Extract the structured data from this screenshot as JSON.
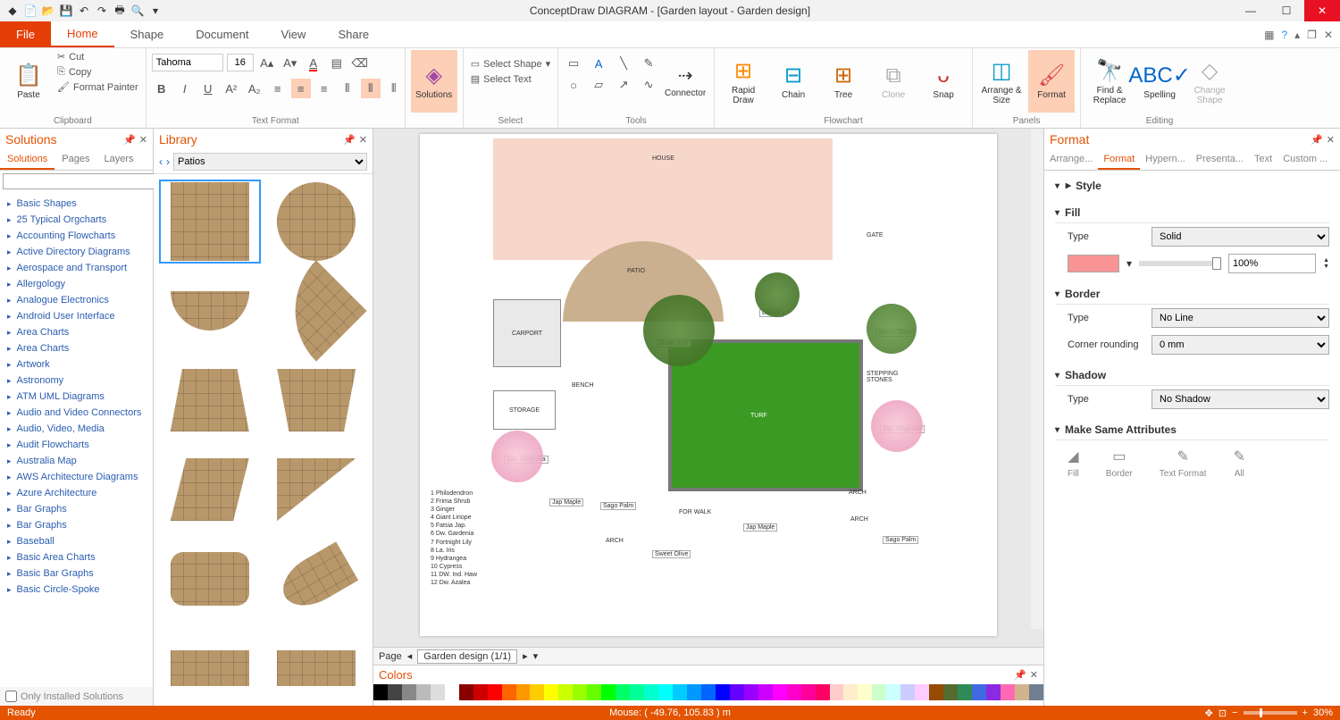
{
  "title": "ConceptDraw DIAGRAM - [Garden layout - Garden design]",
  "menubar": {
    "file": "File",
    "tabs": [
      "Home",
      "Shape",
      "Document",
      "View",
      "Share"
    ],
    "active": "Home"
  },
  "ribbon": {
    "clipboard": {
      "paste": "Paste",
      "cut": "Cut",
      "copy": "Copy",
      "painter": "Format Painter",
      "label": "Clipboard"
    },
    "text": {
      "font": "Tahoma",
      "size": "16",
      "label": "Text Format"
    },
    "solutions": {
      "label": "Solutions"
    },
    "select": {
      "shape": "Select Shape",
      "text": "Select Text",
      "label": "Select"
    },
    "tools": {
      "connector": "Connector",
      "label": "Tools"
    },
    "flowchart": {
      "rapid": "Rapid Draw",
      "chain": "Chain",
      "tree": "Tree",
      "clone": "Clone",
      "snap": "Snap",
      "label": "Flowchart"
    },
    "panels": {
      "arrange": "Arrange & Size",
      "format": "Format",
      "label": "Panels"
    },
    "editing": {
      "find": "Find & Replace",
      "spelling": "Spelling",
      "change": "Change Shape",
      "label": "Editing"
    }
  },
  "solutions_panel": {
    "title": "Solutions",
    "tabs": [
      "Solutions",
      "Pages",
      "Layers"
    ],
    "items": [
      "Basic Shapes",
      "25 Typical Orgcharts",
      "Accounting Flowcharts",
      "Active Directory Diagrams",
      "Aerospace and Transport",
      "Allergology",
      "Analogue Electronics",
      "Android User Interface",
      "Area Charts",
      "Area Charts",
      "Artwork",
      "Astronomy",
      "ATM UML Diagrams",
      "Audio and Video Connectors",
      "Audio, Video, Media",
      "Audit Flowcharts",
      "Australia Map",
      "AWS Architecture Diagrams",
      "Azure Architecture",
      "Bar Graphs",
      "Bar Graphs",
      "Baseball",
      "Basic Area Charts",
      "Basic Bar Graphs",
      "Basic Circle-Spoke"
    ],
    "only_installed": "Only Installed Solutions"
  },
  "library_panel": {
    "title": "Library",
    "category": "Patios"
  },
  "canvas": {
    "labels": {
      "house": "HOUSE",
      "patio": "PATIO",
      "carport": "CARPORT",
      "storage": "STORAGE",
      "bench": "BENCH",
      "turf": "TURF",
      "gate": "GATE",
      "forwalk": "FOR WALK",
      "stepping": "STEPPING STONES",
      "drake": "Drake Elm",
      "locust": "Locust",
      "sweetolive": "Sweet Olive",
      "japmag": "Jap. Magnolia",
      "japmaple": "Jap Maple",
      "sagopalm": "Sago Palm",
      "arch": "ARCH"
    },
    "legend": [
      "1  Philodendron",
      "2  Frima Shrub",
      "3  Ginger",
      "4  Giant Liriope",
      "5  Fatsia Jap.",
      "6  Dw. Gardenia",
      "7  Fortnight Lily",
      "8  La. Iris",
      "9  Hydrangea",
      "10 Cypress",
      "11 DW. Ind. Haw",
      "12 Dw. Azalea"
    ],
    "page_tab": "Garden design (1/1)",
    "page_label": "Page"
  },
  "colors_panel": {
    "title": "Colors"
  },
  "format_panel": {
    "title": "Format",
    "tabs": [
      "Arrange...",
      "Format",
      "Hypern...",
      "Presenta...",
      "Text",
      "Custom ..."
    ],
    "style": "Style",
    "fill": {
      "h": "Fill",
      "type_l": "Type",
      "type_v": "Solid",
      "opacity": "100%"
    },
    "border": {
      "h": "Border",
      "type_l": "Type",
      "type_v": "No Line",
      "corner_l": "Corner rounding",
      "corner_v": "0 mm"
    },
    "shadow": {
      "h": "Shadow",
      "type_l": "Type",
      "type_v": "No Shadow"
    },
    "msa": {
      "h": "Make Same Attributes",
      "fill": "Fill",
      "border": "Border",
      "text": "Text Format",
      "all": "All"
    }
  },
  "status": {
    "ready": "Ready",
    "mouse": "Mouse: ( -49.76, 105.83 ) m",
    "zoom": "30%"
  },
  "swatches": [
    "#000",
    "#444",
    "#888",
    "#bbb",
    "#ddd",
    "#fff",
    "#800",
    "#c00",
    "#f00",
    "#f60",
    "#f90",
    "#fc0",
    "#ff0",
    "#cf0",
    "#9f0",
    "#6f0",
    "#0f0",
    "#0f6",
    "#0f9",
    "#0fc",
    "#0ff",
    "#0cf",
    "#09f",
    "#06f",
    "#00f",
    "#60f",
    "#90f",
    "#c0f",
    "#f0f",
    "#f0c",
    "#f09",
    "#f06",
    "#fcc",
    "#fec",
    "#ffc",
    "#cfc",
    "#cff",
    "#ccf",
    "#fcf",
    "#964b00",
    "#556b2f",
    "#2e8b57",
    "#4169e1",
    "#8a2be2",
    "#ff69b4",
    "#d2b48c",
    "#708090"
  ]
}
